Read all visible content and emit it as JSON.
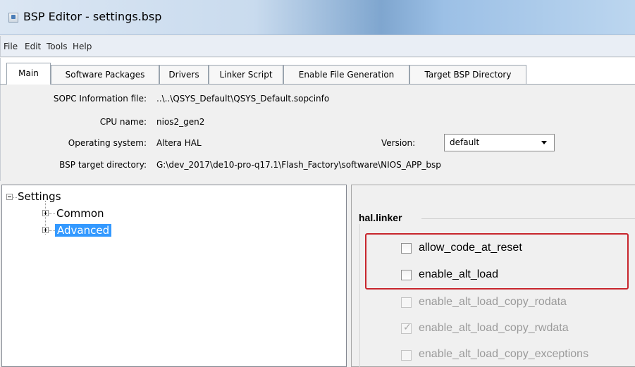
{
  "window": {
    "title": "BSP Editor - settings.bsp"
  },
  "menu": [
    "File",
    "Edit",
    "Tools",
    "Help"
  ],
  "tabs": [
    {
      "label": "Main",
      "active": true
    },
    {
      "label": "Software Packages",
      "active": false
    },
    {
      "label": "Drivers",
      "active": false
    },
    {
      "label": "Linker Script",
      "active": false
    },
    {
      "label": "Enable File Generation",
      "active": false
    },
    {
      "label": "Target BSP Directory",
      "active": false
    }
  ],
  "info": {
    "sopc_label": "SOPC Information file:",
    "sopc_value": "..\\..\\QSYS_Default\\QSYS_Default.sopcinfo",
    "cpu_label": "CPU name:",
    "cpu_value": "nios2_gen2",
    "os_label": "Operating system:",
    "os_value": "Altera HAL",
    "version_label": "Version:",
    "version_value": "default",
    "bsp_dir_label": "BSP target directory:",
    "bsp_dir_value": "G:\\dev_2017\\de10-pro-q17.1\\Flash_Factory\\software\\NIOS_APP_bsp"
  },
  "tree": {
    "root": "Settings",
    "children": [
      {
        "label": "Common",
        "selected": false
      },
      {
        "label": "Advanced",
        "selected": true
      }
    ]
  },
  "settings_panel": {
    "group_title": "hal.linker",
    "checkboxes": [
      {
        "label": "allow_code_at_reset",
        "checked": false,
        "enabled": true
      },
      {
        "label": "enable_alt_load",
        "checked": false,
        "enabled": true
      },
      {
        "label": "enable_alt_load_copy_rodata",
        "checked": false,
        "enabled": false
      },
      {
        "label": "enable_alt_load_copy_rwdata",
        "checked": true,
        "enabled": false
      },
      {
        "label": "enable_alt_load_copy_exceptions",
        "checked": false,
        "enabled": false
      }
    ]
  },
  "colors": {
    "highlight": "#c8262d",
    "selection": "#3399ff"
  }
}
